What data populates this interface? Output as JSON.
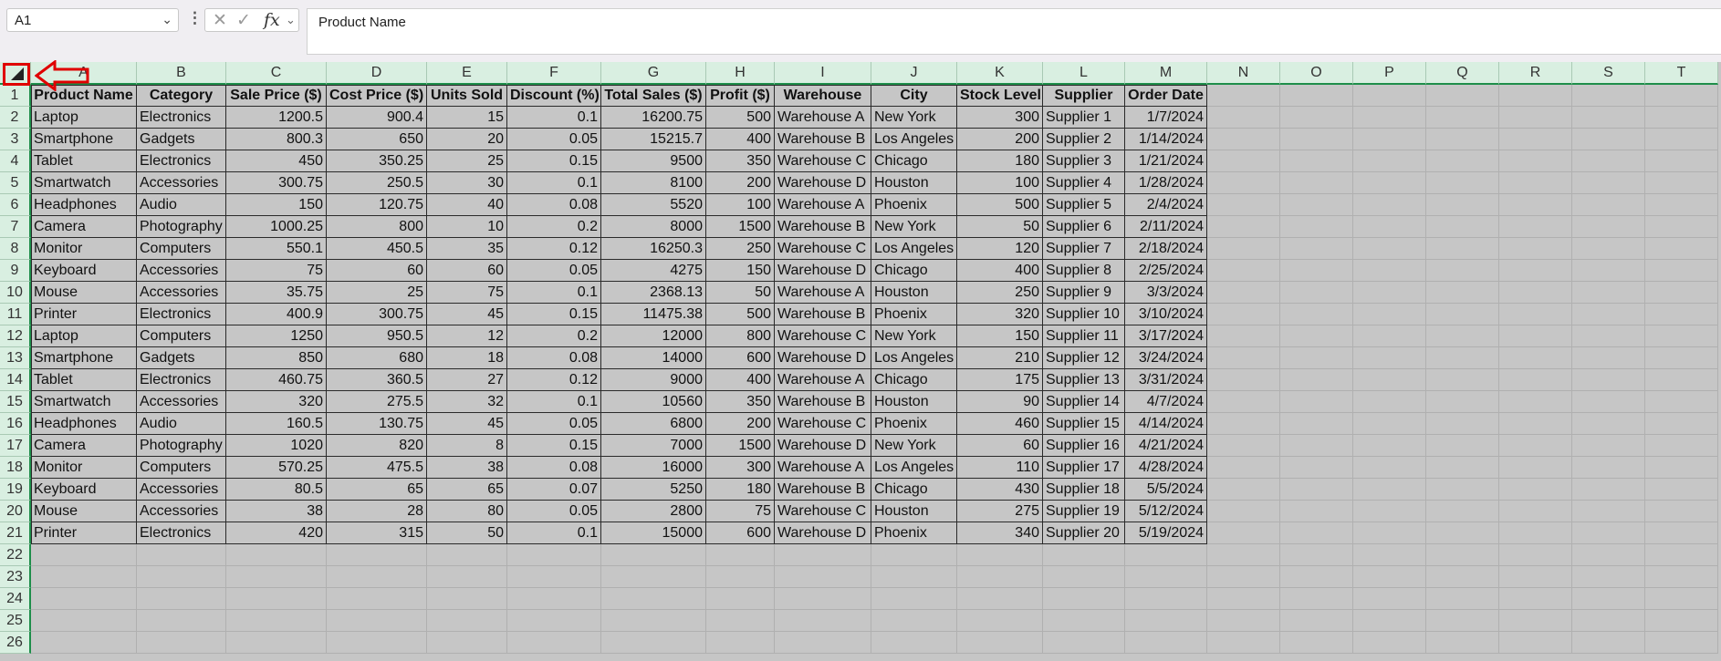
{
  "name_box": {
    "value": "A1"
  },
  "formula_bar": {
    "content": "Product Name",
    "fx_label": "fx"
  },
  "columns": [
    "A",
    "B",
    "C",
    "D",
    "E",
    "F",
    "G",
    "H",
    "I",
    "J",
    "K",
    "L",
    "M",
    "N",
    "O",
    "P",
    "Q",
    "R",
    "S",
    "T"
  ],
  "row_numbers": [
    "1",
    "2",
    "3",
    "4",
    "5",
    "6",
    "7",
    "8",
    "9",
    "10",
    "11",
    "12",
    "13",
    "14",
    "15",
    "16",
    "17",
    "18",
    "19",
    "20",
    "21",
    "22",
    "23",
    "24",
    "25",
    "26"
  ],
  "table": {
    "headers": [
      "Product Name",
      "Category",
      "Sale Price ($)",
      "Cost Price ($)",
      "Units Sold",
      "Discount (%)",
      "Total Sales ($)",
      "Profit ($)",
      "Warehouse",
      "City",
      "Stock Level",
      "Supplier",
      "Order Date"
    ],
    "rows": [
      [
        "Laptop",
        "Electronics",
        "1200.5",
        "900.4",
        "15",
        "0.1",
        "16200.75",
        "500",
        "Warehouse A",
        "New York",
        "300",
        "Supplier 1",
        "1/7/2024"
      ],
      [
        "Smartphone",
        "Gadgets",
        "800.3",
        "650",
        "20",
        "0.05",
        "15215.7",
        "400",
        "Warehouse B",
        "Los Angeles",
        "200",
        "Supplier 2",
        "1/14/2024"
      ],
      [
        "Tablet",
        "Electronics",
        "450",
        "350.25",
        "25",
        "0.15",
        "9500",
        "350",
        "Warehouse C",
        "Chicago",
        "180",
        "Supplier 3",
        "1/21/2024"
      ],
      [
        "Smartwatch",
        "Accessories",
        "300.75",
        "250.5",
        "30",
        "0.1",
        "8100",
        "200",
        "Warehouse D",
        "Houston",
        "100",
        "Supplier 4",
        "1/28/2024"
      ],
      [
        "Headphones",
        "Audio",
        "150",
        "120.75",
        "40",
        "0.08",
        "5520",
        "100",
        "Warehouse A",
        "Phoenix",
        "500",
        "Supplier 5",
        "2/4/2024"
      ],
      [
        "Camera",
        "Photography",
        "1000.25",
        "800",
        "10",
        "0.2",
        "8000",
        "1500",
        "Warehouse B",
        "New York",
        "50",
        "Supplier 6",
        "2/11/2024"
      ],
      [
        "Monitor",
        "Computers",
        "550.1",
        "450.5",
        "35",
        "0.12",
        "16250.3",
        "250",
        "Warehouse C",
        "Los Angeles",
        "120",
        "Supplier 7",
        "2/18/2024"
      ],
      [
        "Keyboard",
        "Accessories",
        "75",
        "60",
        "60",
        "0.05",
        "4275",
        "150",
        "Warehouse D",
        "Chicago",
        "400",
        "Supplier 8",
        "2/25/2024"
      ],
      [
        "Mouse",
        "Accessories",
        "35.75",
        "25",
        "75",
        "0.1",
        "2368.13",
        "50",
        "Warehouse A",
        "Houston",
        "250",
        "Supplier 9",
        "3/3/2024"
      ],
      [
        "Printer",
        "Electronics",
        "400.9",
        "300.75",
        "45",
        "0.15",
        "11475.38",
        "500",
        "Warehouse B",
        "Phoenix",
        "320",
        "Supplier 10",
        "3/10/2024"
      ],
      [
        "Laptop",
        "Computers",
        "1250",
        "950.5",
        "12",
        "0.2",
        "12000",
        "800",
        "Warehouse C",
        "New York",
        "150",
        "Supplier 11",
        "3/17/2024"
      ],
      [
        "Smartphone",
        "Gadgets",
        "850",
        "680",
        "18",
        "0.08",
        "14000",
        "600",
        "Warehouse D",
        "Los Angeles",
        "210",
        "Supplier 12",
        "3/24/2024"
      ],
      [
        "Tablet",
        "Electronics",
        "460.75",
        "360.5",
        "27",
        "0.12",
        "9000",
        "400",
        "Warehouse A",
        "Chicago",
        "175",
        "Supplier 13",
        "3/31/2024"
      ],
      [
        "Smartwatch",
        "Accessories",
        "320",
        "275.5",
        "32",
        "0.1",
        "10560",
        "350",
        "Warehouse B",
        "Houston",
        "90",
        "Supplier 14",
        "4/7/2024"
      ],
      [
        "Headphones",
        "Audio",
        "160.5",
        "130.75",
        "45",
        "0.05",
        "6800",
        "200",
        "Warehouse C",
        "Phoenix",
        "460",
        "Supplier 15",
        "4/14/2024"
      ],
      [
        "Camera",
        "Photography",
        "1020",
        "820",
        "8",
        "0.15",
        "7000",
        "1500",
        "Warehouse D",
        "New York",
        "60",
        "Supplier 16",
        "4/21/2024"
      ],
      [
        "Monitor",
        "Computers",
        "570.25",
        "475.5",
        "38",
        "0.08",
        "16000",
        "300",
        "Warehouse A",
        "Los Angeles",
        "110",
        "Supplier 17",
        "4/28/2024"
      ],
      [
        "Keyboard",
        "Accessories",
        "80.5",
        "65",
        "65",
        "0.07",
        "5250",
        "180",
        "Warehouse B",
        "Chicago",
        "430",
        "Supplier 18",
        "5/5/2024"
      ],
      [
        "Mouse",
        "Accessories",
        "38",
        "28",
        "80",
        "0.05",
        "2800",
        "75",
        "Warehouse C",
        "Houston",
        "275",
        "Supplier 19",
        "5/12/2024"
      ],
      [
        "Printer",
        "Electronics",
        "420",
        "315",
        "50",
        "0.1",
        "15000",
        "600",
        "Warehouse D",
        "Phoenix",
        "340",
        "Supplier 20",
        "5/19/2024"
      ]
    ]
  },
  "colors": {
    "header_bg": "#d9efe1",
    "header_accent": "#1e8e4a",
    "selection_bg": "#c6c6c6",
    "highlight": "#e00000"
  },
  "icons": {
    "select_all": "select-all-triangle-icon",
    "annotation": "left-arrow-icon"
  }
}
